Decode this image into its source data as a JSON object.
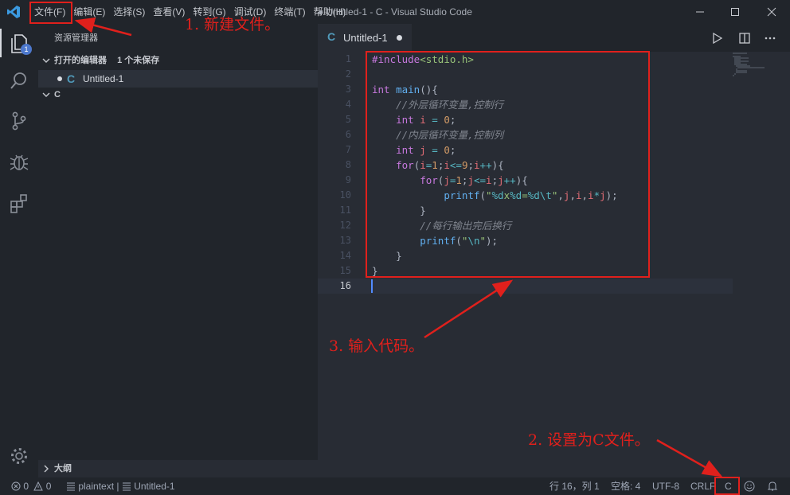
{
  "titlebar": {
    "menu": [
      "文件(F)",
      "编辑(E)",
      "选择(S)",
      "查看(V)",
      "转到(G)",
      "调试(D)",
      "终端(T)",
      "帮助(H)"
    ],
    "window_title": "● Untitled-1 - C - Visual Studio Code",
    "icons": [
      "vscode-logo",
      "minimize-icon",
      "maximize-icon",
      "close-icon"
    ]
  },
  "activity_bar": {
    "icons": [
      "explorer-icon",
      "search-icon",
      "source-control-icon",
      "debug-icon",
      "extensions-icon",
      "settings-gear-icon"
    ],
    "explorer_badge": "1"
  },
  "sidebar": {
    "title": "资源管理器",
    "open_editors": {
      "label": "打开的编辑器",
      "unsaved": "1 个未保存"
    },
    "open_file": {
      "icon": "C",
      "name": "Untitled-1"
    },
    "folder": "C",
    "outline": "大纲"
  },
  "editor": {
    "tab": {
      "icon": "C",
      "label": "Untitled-1"
    },
    "tab_actions": [
      "run-icon",
      "split-editor-icon",
      "more-icon"
    ],
    "line_numbers": [
      "1",
      "2",
      "3",
      "4",
      "5",
      "6",
      "7",
      "8",
      "9",
      "10",
      "11",
      "12",
      "13",
      "14",
      "15",
      "16"
    ],
    "code": [
      "#include<stdio.h>",
      "",
      "int main(){",
      "    //外层循环变量,控制行",
      "    int i = 0;",
      "    //内层循环变量,控制列",
      "    int j = 0;",
      "    for(i=1;i<=9;i++){",
      "        for(j=1;j<=i;j++){",
      "            printf(\"%dx%d=%d\\t\",j,i,i*j);",
      "        }",
      "        //每行输出完后换行",
      "        printf(\"\\n\");",
      "    }",
      "}",
      ""
    ]
  },
  "status_bar": {
    "errors": "0",
    "warnings": "0",
    "language_mode": "plaintext",
    "file": "Untitled-1",
    "cursor_pos": "行 16，列 1",
    "indent": "空格: 4",
    "encoding": "UTF-8",
    "eol": "CRLF",
    "language": "C"
  },
  "annotations": {
    "step1": "1. 新建文件。",
    "step2": "2. 设置为C文件。",
    "step3": "3. 输入代码。",
    "colors": {
      "annotation": "#e0201c"
    }
  }
}
